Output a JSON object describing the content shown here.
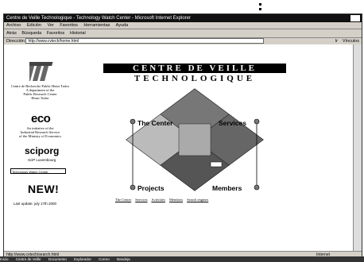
{
  "window": {
    "title": "Centre de Veille Technologique - Technology Watch Center - Microsoft Internet Explorer"
  },
  "menubar": [
    "Archivo",
    "Edición",
    "Ver",
    "Favoritos",
    "Herramientas",
    "Ayuda"
  ],
  "toolbar": [
    "Atrás",
    "Búsqueda",
    "Favoritos",
    "Historial"
  ],
  "addressbar": {
    "label": "Dirección",
    "url": "http://www.cvtech/home.html",
    "go": "Ir",
    "links": "Vínculos"
  },
  "left": {
    "center_line1": "Centre de Recherche Public Henri Tudor",
    "center_line2": "A department of the",
    "center_line3": "Public Research Center",
    "center_line4": "Henri Tudor",
    "eco_logo": "eco",
    "eco_line1": "An initiative of the",
    "eco_line2": "Industrial Research Service",
    "eco_line3": "of the Ministry of Economics",
    "sciporg": "sciporg",
    "sciporg_sub": "SciP Luxembourg",
    "search_placeholder": "Technology Watch Center",
    "new_label": "NEW!",
    "update_text": "Last update: july 17th 2000"
  },
  "header": {
    "line1": "CENTRE DE VEILLE",
    "line2": "TECHNOLOGIQUE"
  },
  "nav": {
    "the_center": "The Center",
    "services": "Services",
    "projects": "Projects",
    "members": "Members"
  },
  "bottom_links": [
    "The Center",
    "Services",
    "Activities",
    "Members",
    "Search engines"
  ],
  "statusbar": {
    "text": "http://www.cvtech/search.html",
    "zone": "Internet"
  },
  "taskbar": [
    "Inicio",
    "Centre de Veille",
    "Documento",
    "Explorador",
    "Correo",
    "Bandeja"
  ]
}
